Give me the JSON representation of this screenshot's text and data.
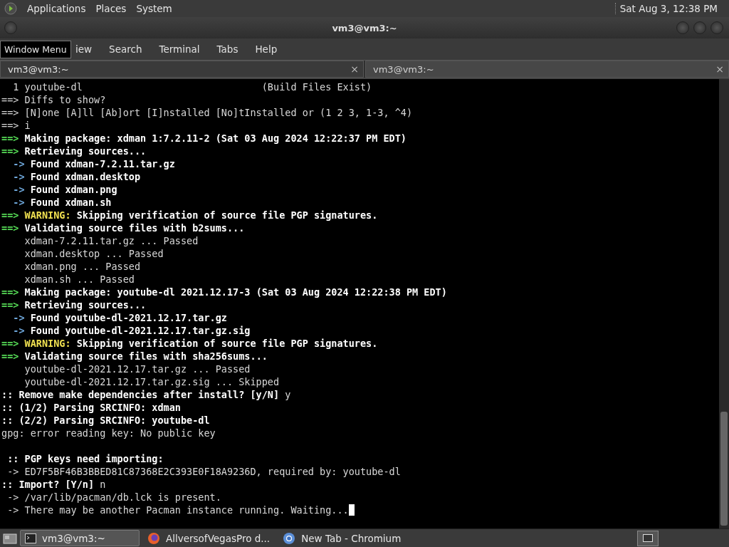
{
  "top_panel": {
    "menus": [
      "Applications",
      "Places",
      "System"
    ],
    "clock": "Sat Aug  3, 12:38 PM"
  },
  "window": {
    "title": "vm3@vm3:~"
  },
  "tooltip": "Window Menu",
  "menubar": [
    "iew",
    "Search",
    "Terminal",
    "Tabs",
    "Help"
  ],
  "tabs": [
    {
      "label": "vm3@vm3:~",
      "close": "×",
      "selected": true
    },
    {
      "label": "vm3@vm3:~",
      "close": "×",
      "selected": false
    }
  ],
  "terminal": {
    "lines": [
      {
        "kind": "text",
        "segments": [
          {
            "text": "  1 youtube-dl                               (Build Files Exist)",
            "kind": "plain"
          }
        ]
      },
      {
        "kind": "text",
        "segments": [
          {
            "text": "==> Diffs to show?",
            "kind": "plain"
          }
        ]
      },
      {
        "kind": "text",
        "segments": [
          {
            "text": "==> [N]one [A]ll [Ab]ort [I]nstalled [No]tInstalled or (1 2 3, 1-3, ^4)",
            "kind": "plain"
          }
        ]
      },
      {
        "kind": "text",
        "segments": [
          {
            "text": "==> i",
            "kind": "plain"
          }
        ]
      },
      {
        "kind": "text",
        "segments": [
          {
            "text": "==>",
            "kind": "prompt"
          },
          {
            "text": " Making package: xdman 1:7.2.11-2 (Sat 03 Aug 2024 12:22:37 PM EDT)",
            "kind": "bold"
          }
        ]
      },
      {
        "kind": "text",
        "segments": [
          {
            "text": "==>",
            "kind": "prompt"
          },
          {
            "text": " Retrieving sources...",
            "kind": "bold"
          }
        ]
      },
      {
        "kind": "text",
        "segments": [
          {
            "text": "  ->",
            "kind": "arrow"
          },
          {
            "text": " Found xdman-7.2.11.tar.gz",
            "kind": "bold"
          }
        ]
      },
      {
        "kind": "text",
        "segments": [
          {
            "text": "  ->",
            "kind": "arrow"
          },
          {
            "text": " Found xdman.desktop",
            "kind": "bold"
          }
        ]
      },
      {
        "kind": "text",
        "segments": [
          {
            "text": "  ->",
            "kind": "arrow"
          },
          {
            "text": " Found xdman.png",
            "kind": "bold"
          }
        ]
      },
      {
        "kind": "text",
        "segments": [
          {
            "text": "  ->",
            "kind": "arrow"
          },
          {
            "text": " Found xdman.sh",
            "kind": "bold"
          }
        ]
      },
      {
        "kind": "text",
        "segments": [
          {
            "text": "==>",
            "kind": "prompt"
          },
          {
            "text": " WARNING:",
            "kind": "warning"
          },
          {
            "text": " Skipping verification of source file PGP signatures.",
            "kind": "bold"
          }
        ]
      },
      {
        "kind": "text",
        "segments": [
          {
            "text": "==>",
            "kind": "prompt"
          },
          {
            "text": " Validating source files with b2sums...",
            "kind": "bold"
          }
        ]
      },
      {
        "kind": "text",
        "segments": [
          {
            "text": "    xdman-7.2.11.tar.gz ... Passed",
            "kind": "plain"
          }
        ]
      },
      {
        "kind": "text",
        "segments": [
          {
            "text": "    xdman.desktop ... Passed",
            "kind": "plain"
          }
        ]
      },
      {
        "kind": "text",
        "segments": [
          {
            "text": "    xdman.png ... Passed",
            "kind": "plain"
          }
        ]
      },
      {
        "kind": "text",
        "segments": [
          {
            "text": "    xdman.sh ... Passed",
            "kind": "plain"
          }
        ]
      },
      {
        "kind": "text",
        "segments": [
          {
            "text": "==>",
            "kind": "prompt"
          },
          {
            "text": " Making package: youtube-dl 2021.12.17-3 (Sat 03 Aug 2024 12:22:38 PM EDT)",
            "kind": "bold"
          }
        ]
      },
      {
        "kind": "text",
        "segments": [
          {
            "text": "==>",
            "kind": "prompt"
          },
          {
            "text": " Retrieving sources...",
            "kind": "bold"
          }
        ]
      },
      {
        "kind": "text",
        "segments": [
          {
            "text": "  ->",
            "kind": "arrow"
          },
          {
            "text": " Found youtube-dl-2021.12.17.tar.gz",
            "kind": "bold"
          }
        ]
      },
      {
        "kind": "text",
        "segments": [
          {
            "text": "  ->",
            "kind": "arrow"
          },
          {
            "text": " Found youtube-dl-2021.12.17.tar.gz.sig",
            "kind": "bold"
          }
        ]
      },
      {
        "kind": "text",
        "segments": [
          {
            "text": "==>",
            "kind": "prompt"
          },
          {
            "text": " WARNING:",
            "kind": "warning"
          },
          {
            "text": " Skipping verification of source file PGP signatures.",
            "kind": "bold"
          }
        ]
      },
      {
        "kind": "text",
        "segments": [
          {
            "text": "==>",
            "kind": "prompt"
          },
          {
            "text": " Validating source files with sha256sums...",
            "kind": "bold"
          }
        ]
      },
      {
        "kind": "text",
        "segments": [
          {
            "text": "    youtube-dl-2021.12.17.tar.gz ... Passed",
            "kind": "plain"
          }
        ]
      },
      {
        "kind": "text",
        "segments": [
          {
            "text": "    youtube-dl-2021.12.17.tar.gz.sig ... Skipped",
            "kind": "plain"
          }
        ]
      },
      {
        "kind": "text",
        "segments": [
          {
            "text": ":: Remove make dependencies after install? [y/N]",
            "kind": "bold"
          },
          {
            "text": " y",
            "kind": "plain"
          }
        ]
      },
      {
        "kind": "text",
        "segments": [
          {
            "text": ":: (1/2) Parsing SRCINFO: xdman",
            "kind": "bold"
          }
        ]
      },
      {
        "kind": "text",
        "segments": [
          {
            "text": ":: (2/2) Parsing SRCINFO: youtube-dl",
            "kind": "bold"
          }
        ]
      },
      {
        "kind": "text",
        "segments": [
          {
            "text": "gpg: error reading key: No public key",
            "kind": "plain"
          }
        ]
      },
      {
        "kind": "blank"
      },
      {
        "kind": "text",
        "segments": [
          {
            "text": " :: PGP keys need importing:",
            "kind": "bold"
          }
        ]
      },
      {
        "kind": "text",
        "segments": [
          {
            "text": " -> ED7F5BF46B3BBED81C87368E2C393E0F18A9236D, required by: youtube-dl",
            "kind": "plain"
          }
        ]
      },
      {
        "kind": "text",
        "segments": [
          {
            "text": ":: Import? [Y/n]",
            "kind": "bold"
          },
          {
            "text": " n",
            "kind": "plain"
          }
        ]
      },
      {
        "kind": "text",
        "segments": [
          {
            "text": " -> /var/lib/pacman/db.lck is present.",
            "kind": "plain"
          }
        ]
      },
      {
        "kind": "cursor",
        "segments": [
          {
            "text": " -> There may be another Pacman instance running. Waiting...",
            "kind": "plain"
          }
        ]
      }
    ]
  },
  "taskbar": {
    "items": [
      {
        "label": "vm3@vm3:~",
        "kind": "terminal",
        "selected": true
      },
      {
        "label": "AllversofVegasPro d...",
        "kind": "firefox",
        "selected": false
      },
      {
        "label": "New Tab - Chromium",
        "kind": "chromium",
        "selected": false
      }
    ]
  }
}
